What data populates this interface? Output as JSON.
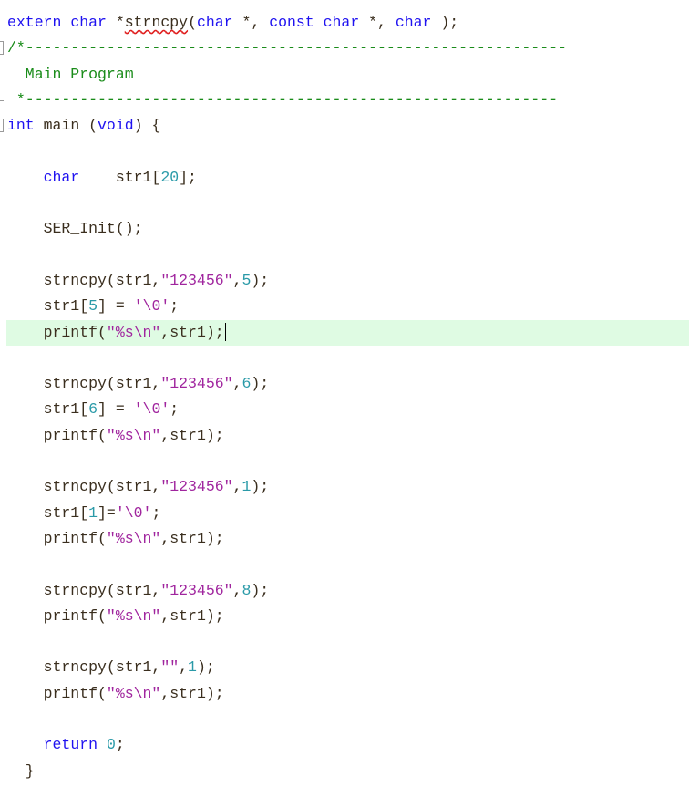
{
  "editor": {
    "language": "C",
    "current_line_index": 12,
    "lines": [
      {
        "tokens": [
          {
            "t": "kw",
            "v": "extern"
          },
          {
            "t": "tx",
            "v": " "
          },
          {
            "t": "kw",
            "v": "char"
          },
          {
            "t": "tx",
            "v": " *"
          },
          {
            "t": "err",
            "v": "strncpy"
          },
          {
            "t": "tx",
            "v": "("
          },
          {
            "t": "kw",
            "v": "char"
          },
          {
            "t": "tx",
            "v": " *, "
          },
          {
            "t": "kw",
            "v": "const"
          },
          {
            "t": "tx",
            "v": " "
          },
          {
            "t": "kw",
            "v": "char"
          },
          {
            "t": "tx",
            "v": " *, "
          },
          {
            "t": "kw",
            "v": "char"
          },
          {
            "t": "tx",
            "v": " );"
          }
        ]
      },
      {
        "fold": "open",
        "tokens": [
          {
            "t": "cm",
            "v": "/*------------------------------------------------------------"
          }
        ]
      },
      {
        "tokens": [
          {
            "t": "cm",
            "v": "  Main Program"
          }
        ]
      },
      {
        "fold": "end",
        "tokens": [
          {
            "t": "cm",
            "v": " *-----------------------------------------------------------"
          }
        ]
      },
      {
        "fold": "open",
        "tokens": [
          {
            "t": "kw",
            "v": "int"
          },
          {
            "t": "tx",
            "v": " main ("
          },
          {
            "t": "kw",
            "v": "void"
          },
          {
            "t": "tx",
            "v": ") {"
          }
        ]
      },
      {
        "tokens": []
      },
      {
        "tokens": [
          {
            "t": "tx",
            "v": "    "
          },
          {
            "t": "kw",
            "v": "char"
          },
          {
            "t": "tx",
            "v": "    str1["
          },
          {
            "t": "num",
            "v": "20"
          },
          {
            "t": "tx",
            "v": "];"
          }
        ]
      },
      {
        "tokens": []
      },
      {
        "tokens": [
          {
            "t": "tx",
            "v": "    SER_Init();"
          }
        ]
      },
      {
        "tokens": []
      },
      {
        "tokens": [
          {
            "t": "tx",
            "v": "    strncpy(str1,"
          },
          {
            "t": "str",
            "v": "\"123456\""
          },
          {
            "t": "tx",
            "v": ","
          },
          {
            "t": "num",
            "v": "5"
          },
          {
            "t": "tx",
            "v": ");"
          }
        ]
      },
      {
        "tokens": [
          {
            "t": "tx",
            "v": "    str1["
          },
          {
            "t": "num",
            "v": "5"
          },
          {
            "t": "tx",
            "v": "] = "
          },
          {
            "t": "str",
            "v": "'\\0'"
          },
          {
            "t": "tx",
            "v": ";"
          }
        ]
      },
      {
        "tokens": [
          {
            "t": "tx",
            "v": "    printf("
          },
          {
            "t": "str",
            "v": "\"%s\\n\""
          },
          {
            "t": "tx",
            "v": ",str1);"
          }
        ]
      },
      {
        "tokens": []
      },
      {
        "tokens": [
          {
            "t": "tx",
            "v": "    strncpy(str1,"
          },
          {
            "t": "str",
            "v": "\"123456\""
          },
          {
            "t": "tx",
            "v": ","
          },
          {
            "t": "num",
            "v": "6"
          },
          {
            "t": "tx",
            "v": ");"
          }
        ]
      },
      {
        "tokens": [
          {
            "t": "tx",
            "v": "    str1["
          },
          {
            "t": "num",
            "v": "6"
          },
          {
            "t": "tx",
            "v": "] = "
          },
          {
            "t": "str",
            "v": "'\\0'"
          },
          {
            "t": "tx",
            "v": ";"
          }
        ]
      },
      {
        "tokens": [
          {
            "t": "tx",
            "v": "    printf("
          },
          {
            "t": "str",
            "v": "\"%s\\n\""
          },
          {
            "t": "tx",
            "v": ",str1);"
          }
        ]
      },
      {
        "tokens": []
      },
      {
        "tokens": [
          {
            "t": "tx",
            "v": "    strncpy(str1,"
          },
          {
            "t": "str",
            "v": "\"123456\""
          },
          {
            "t": "tx",
            "v": ","
          },
          {
            "t": "num",
            "v": "1"
          },
          {
            "t": "tx",
            "v": ");"
          }
        ]
      },
      {
        "tokens": [
          {
            "t": "tx",
            "v": "    str1["
          },
          {
            "t": "num",
            "v": "1"
          },
          {
            "t": "tx",
            "v": "]="
          },
          {
            "t": "str",
            "v": "'\\0'"
          },
          {
            "t": "tx",
            "v": ";"
          }
        ]
      },
      {
        "tokens": [
          {
            "t": "tx",
            "v": "    printf("
          },
          {
            "t": "str",
            "v": "\"%s\\n\""
          },
          {
            "t": "tx",
            "v": ",str1);"
          }
        ]
      },
      {
        "tokens": []
      },
      {
        "tokens": [
          {
            "t": "tx",
            "v": "    strncpy(str1,"
          },
          {
            "t": "str",
            "v": "\"123456\""
          },
          {
            "t": "tx",
            "v": ","
          },
          {
            "t": "num",
            "v": "8"
          },
          {
            "t": "tx",
            "v": ");"
          }
        ]
      },
      {
        "tokens": [
          {
            "t": "tx",
            "v": "    printf("
          },
          {
            "t": "str",
            "v": "\"%s\\n\""
          },
          {
            "t": "tx",
            "v": ",str1);"
          }
        ]
      },
      {
        "tokens": []
      },
      {
        "tokens": [
          {
            "t": "tx",
            "v": "    strncpy(str1,"
          },
          {
            "t": "str",
            "v": "\"\""
          },
          {
            "t": "tx",
            "v": ","
          },
          {
            "t": "num",
            "v": "1"
          },
          {
            "t": "tx",
            "v": ");"
          }
        ]
      },
      {
        "tokens": [
          {
            "t": "tx",
            "v": "    printf("
          },
          {
            "t": "str",
            "v": "\"%s\\n\""
          },
          {
            "t": "tx",
            "v": ",str1);"
          }
        ]
      },
      {
        "tokens": []
      },
      {
        "tokens": [
          {
            "t": "tx",
            "v": "    "
          },
          {
            "t": "kw",
            "v": "return"
          },
          {
            "t": "tx",
            "v": " "
          },
          {
            "t": "num",
            "v": "0"
          },
          {
            "t": "tx",
            "v": ";"
          }
        ]
      },
      {
        "tokens": [
          {
            "t": "tx",
            "v": "  }"
          }
        ]
      }
    ]
  },
  "colors": {
    "keyword": "#1f12f0",
    "comment": "#1a8c1a",
    "string": "#a0259e",
    "number": "#2a9aa8",
    "text": "#3a2e1e",
    "current_line_bg": "#dffbe3",
    "error_underline": "#e02020"
  }
}
